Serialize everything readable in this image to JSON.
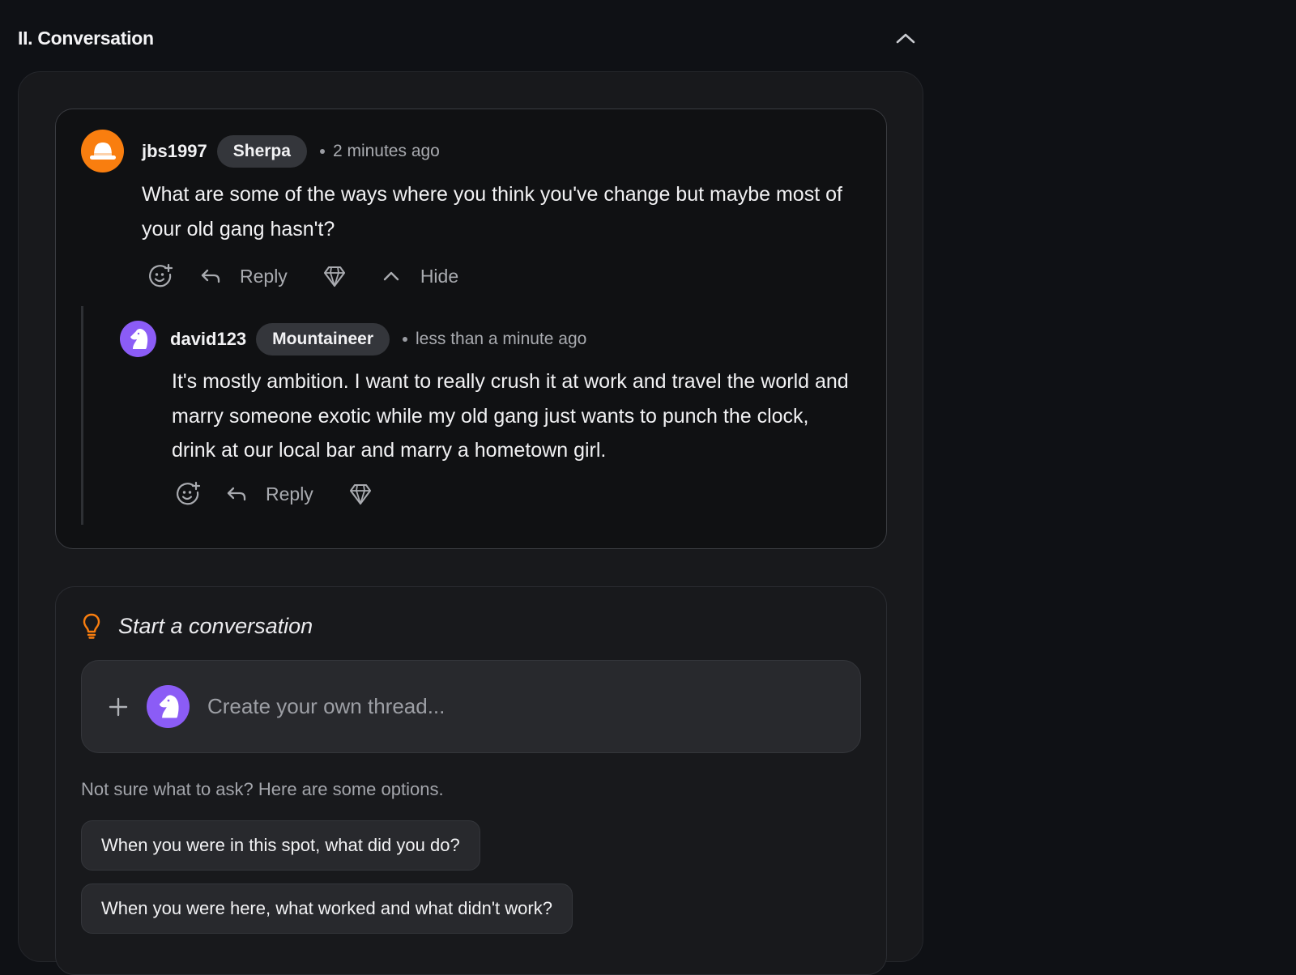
{
  "section": {
    "title": "II. Conversation"
  },
  "thread": {
    "comment": {
      "username": "jbs1997",
      "role": "Sherpa",
      "timestamp": "2 minutes ago",
      "body": "What are some of the ways where you think you've change but maybe most of your old gang hasn't?",
      "reply_label": "Reply",
      "hide_label": "Hide",
      "avatar_color": "#f97e0f"
    },
    "reply": {
      "username": "david123",
      "role": "Mountaineer",
      "timestamp": "less than a minute ago",
      "body": "It's mostly ambition. I want to really crush it at work and travel the world and marry someone exotic while my old gang just wants to punch the clock, drink at our local bar and marry a hometown girl.",
      "reply_label": "Reply",
      "avatar_color": "#8b5cf6"
    }
  },
  "start": {
    "title": "Start a conversation",
    "input_placeholder": "Create your own thread...",
    "hint": "Not sure what to ask? Here are some options.",
    "suggestions": [
      "When you were in this spot, what did you do?",
      "When you were here, what worked and what didn't work?"
    ]
  },
  "colors": {
    "accent_orange": "#f97e0f",
    "accent_purple": "#8b5cf6",
    "background": "#0f1115",
    "card": "#18191c"
  },
  "icons": [
    "chevron-up-icon",
    "hat-icon",
    "knight-icon",
    "add-reaction-icon",
    "reply-arrow-icon",
    "diamond-icon",
    "lightbulb-icon",
    "plus-icon"
  ]
}
